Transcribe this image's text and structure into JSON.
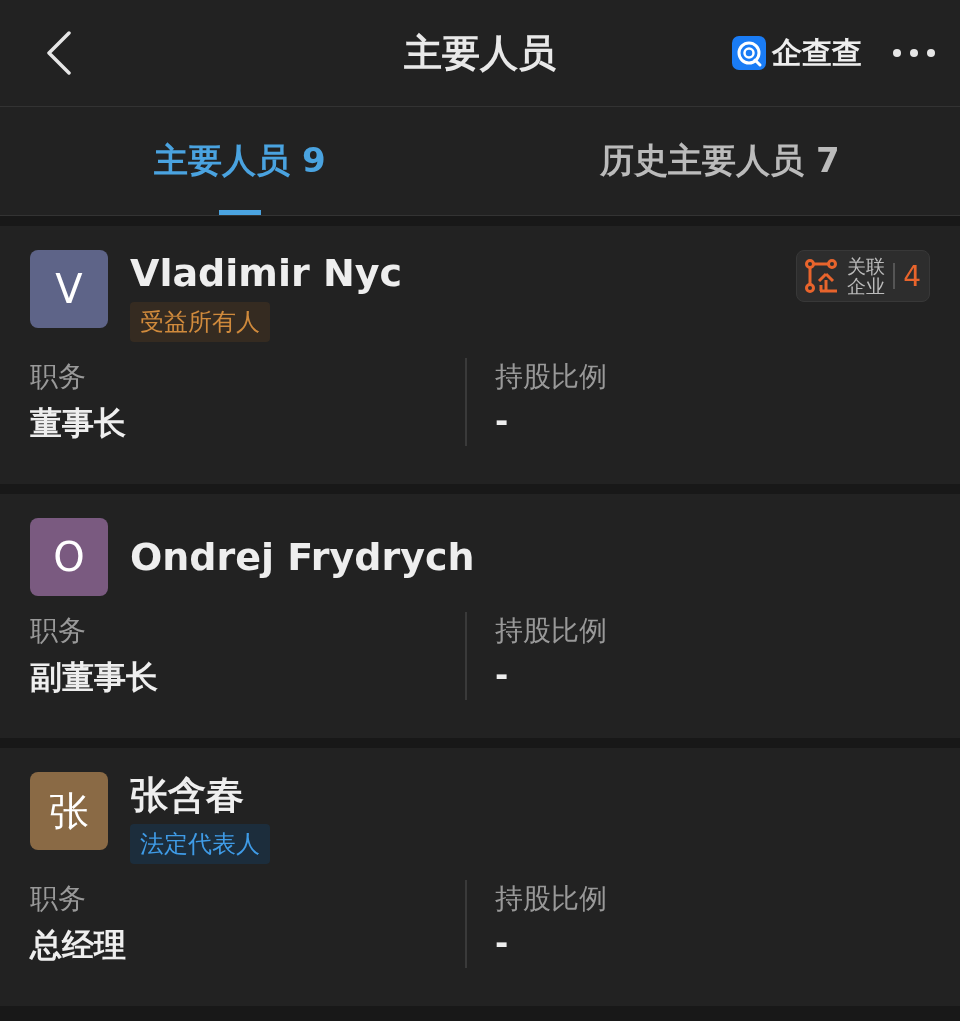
{
  "header": {
    "title": "主要人员",
    "brand": "企查查"
  },
  "tabs": [
    {
      "label": "主要人员 9",
      "selected": true
    },
    {
      "label": "历史主要人员 7",
      "selected": false
    }
  ],
  "people": [
    {
      "initial": "V",
      "color": "#5e6488",
      "name": "Vladimir Nyc",
      "tags": [
        {
          "kind": "beneficiary",
          "label": "受益所有人"
        }
      ],
      "related": {
        "label_1": "关联",
        "label_2": "企业",
        "count": "4"
      },
      "role_label": "职务",
      "role": "董事长",
      "share_label": "持股比例",
      "share": "-"
    },
    {
      "initial": "O",
      "color": "#7a5a80",
      "name": "Ondrej Frydrych",
      "role_label": "职务",
      "role": "副董事长",
      "share_label": "持股比例",
      "share": "-"
    },
    {
      "initial": "张",
      "color": "#8a6a45",
      "name": "张含春",
      "tags": [
        {
          "kind": "legal",
          "label": "法定代表人"
        }
      ],
      "role_label": "职务",
      "role": "总经理",
      "share_label": "持股比例",
      "share": "-"
    }
  ]
}
